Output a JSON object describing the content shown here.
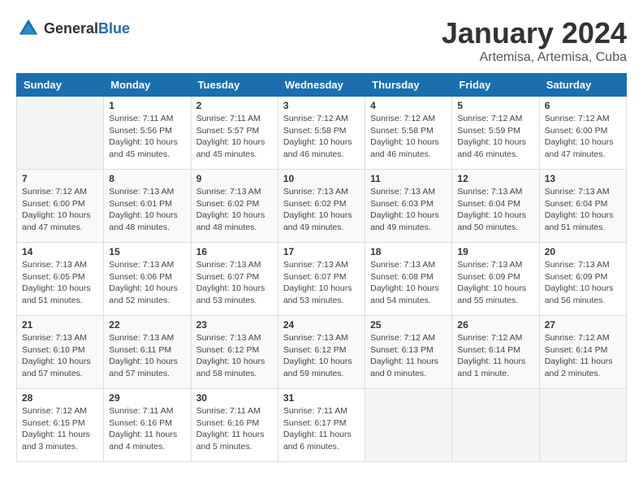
{
  "logo": {
    "general": "General",
    "blue": "Blue"
  },
  "title": "January 2024",
  "subtitle": "Artemisa, Artemisa, Cuba",
  "days_of_week": [
    "Sunday",
    "Monday",
    "Tuesday",
    "Wednesday",
    "Thursday",
    "Friday",
    "Saturday"
  ],
  "weeks": [
    [
      {
        "day": "",
        "info": ""
      },
      {
        "day": "1",
        "info": "Sunrise: 7:11 AM\nSunset: 5:56 PM\nDaylight: 10 hours\nand 45 minutes."
      },
      {
        "day": "2",
        "info": "Sunrise: 7:11 AM\nSunset: 5:57 PM\nDaylight: 10 hours\nand 45 minutes."
      },
      {
        "day": "3",
        "info": "Sunrise: 7:12 AM\nSunset: 5:58 PM\nDaylight: 10 hours\nand 46 minutes."
      },
      {
        "day": "4",
        "info": "Sunrise: 7:12 AM\nSunset: 5:58 PM\nDaylight: 10 hours\nand 46 minutes."
      },
      {
        "day": "5",
        "info": "Sunrise: 7:12 AM\nSunset: 5:59 PM\nDaylight: 10 hours\nand 46 minutes."
      },
      {
        "day": "6",
        "info": "Sunrise: 7:12 AM\nSunset: 6:00 PM\nDaylight: 10 hours\nand 47 minutes."
      }
    ],
    [
      {
        "day": "7",
        "info": "Sunrise: 7:12 AM\nSunset: 6:00 PM\nDaylight: 10 hours\nand 47 minutes."
      },
      {
        "day": "8",
        "info": "Sunrise: 7:13 AM\nSunset: 6:01 PM\nDaylight: 10 hours\nand 48 minutes."
      },
      {
        "day": "9",
        "info": "Sunrise: 7:13 AM\nSunset: 6:02 PM\nDaylight: 10 hours\nand 48 minutes."
      },
      {
        "day": "10",
        "info": "Sunrise: 7:13 AM\nSunset: 6:02 PM\nDaylight: 10 hours\nand 49 minutes."
      },
      {
        "day": "11",
        "info": "Sunrise: 7:13 AM\nSunset: 6:03 PM\nDaylight: 10 hours\nand 49 minutes."
      },
      {
        "day": "12",
        "info": "Sunrise: 7:13 AM\nSunset: 6:04 PM\nDaylight: 10 hours\nand 50 minutes."
      },
      {
        "day": "13",
        "info": "Sunrise: 7:13 AM\nSunset: 6:04 PM\nDaylight: 10 hours\nand 51 minutes."
      }
    ],
    [
      {
        "day": "14",
        "info": "Sunrise: 7:13 AM\nSunset: 6:05 PM\nDaylight: 10 hours\nand 51 minutes."
      },
      {
        "day": "15",
        "info": "Sunrise: 7:13 AM\nSunset: 6:06 PM\nDaylight: 10 hours\nand 52 minutes."
      },
      {
        "day": "16",
        "info": "Sunrise: 7:13 AM\nSunset: 6:07 PM\nDaylight: 10 hours\nand 53 minutes."
      },
      {
        "day": "17",
        "info": "Sunrise: 7:13 AM\nSunset: 6:07 PM\nDaylight: 10 hours\nand 53 minutes."
      },
      {
        "day": "18",
        "info": "Sunrise: 7:13 AM\nSunset: 6:08 PM\nDaylight: 10 hours\nand 54 minutes."
      },
      {
        "day": "19",
        "info": "Sunrise: 7:13 AM\nSunset: 6:09 PM\nDaylight: 10 hours\nand 55 minutes."
      },
      {
        "day": "20",
        "info": "Sunrise: 7:13 AM\nSunset: 6:09 PM\nDaylight: 10 hours\nand 56 minutes."
      }
    ],
    [
      {
        "day": "21",
        "info": "Sunrise: 7:13 AM\nSunset: 6:10 PM\nDaylight: 10 hours\nand 57 minutes."
      },
      {
        "day": "22",
        "info": "Sunrise: 7:13 AM\nSunset: 6:11 PM\nDaylight: 10 hours\nand 57 minutes."
      },
      {
        "day": "23",
        "info": "Sunrise: 7:13 AM\nSunset: 6:12 PM\nDaylight: 10 hours\nand 58 minutes."
      },
      {
        "day": "24",
        "info": "Sunrise: 7:13 AM\nSunset: 6:12 PM\nDaylight: 10 hours\nand 59 minutes."
      },
      {
        "day": "25",
        "info": "Sunrise: 7:12 AM\nSunset: 6:13 PM\nDaylight: 11 hours\nand 0 minutes."
      },
      {
        "day": "26",
        "info": "Sunrise: 7:12 AM\nSunset: 6:14 PM\nDaylight: 11 hours\nand 1 minute."
      },
      {
        "day": "27",
        "info": "Sunrise: 7:12 AM\nSunset: 6:14 PM\nDaylight: 11 hours\nand 2 minutes."
      }
    ],
    [
      {
        "day": "28",
        "info": "Sunrise: 7:12 AM\nSunset: 6:15 PM\nDaylight: 11 hours\nand 3 minutes."
      },
      {
        "day": "29",
        "info": "Sunrise: 7:11 AM\nSunset: 6:16 PM\nDaylight: 11 hours\nand 4 minutes."
      },
      {
        "day": "30",
        "info": "Sunrise: 7:11 AM\nSunset: 6:16 PM\nDaylight: 11 hours\nand 5 minutes."
      },
      {
        "day": "31",
        "info": "Sunrise: 7:11 AM\nSunset: 6:17 PM\nDaylight: 11 hours\nand 6 minutes."
      },
      {
        "day": "",
        "info": ""
      },
      {
        "day": "",
        "info": ""
      },
      {
        "day": "",
        "info": ""
      }
    ]
  ]
}
